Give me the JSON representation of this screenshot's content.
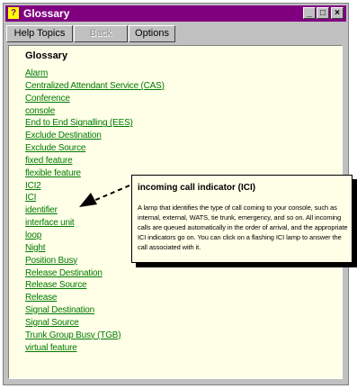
{
  "window": {
    "title": "Glossary",
    "title_icon": "?",
    "controls": {
      "minimize": "_",
      "maximize": "□",
      "close": "×"
    }
  },
  "toolbar": {
    "help_topics_label": "Help Topics",
    "back_label": "Back",
    "options_label": "Options"
  },
  "glossary": {
    "heading": "Glossary",
    "items": [
      "Alarm",
      "Centralized Attendant Service (CAS)",
      "Conference",
      "console",
      "End to End Signalling (EES)",
      "Exclude Destination",
      "Exclude Source",
      "fixed feature",
      "flexible feature",
      "ICI2",
      "ICI",
      "identifier",
      "interface unit",
      "loop",
      "Night",
      "Position Busy",
      "Release Destination",
      "Release Source",
      "Release",
      "Signal Destination",
      "Signal Source",
      "Trunk Group Busy (TGB)",
      "virtual feature"
    ]
  },
  "popup": {
    "title": "incoming call indicator (ICI)",
    "body": "A lamp that identifies the type of call coming to your console, such as internal, external, WATS, tie trunk, emergency, and so on. All incoming calls are queued automatically in the order of arrival, and the appropriate ICI indicators go on. You can click on a flashing ICI lamp to answer the call associated with it."
  },
  "colors": {
    "titlebar": "#800080",
    "link": "#007a00",
    "content_bg": "#ffffe8"
  }
}
